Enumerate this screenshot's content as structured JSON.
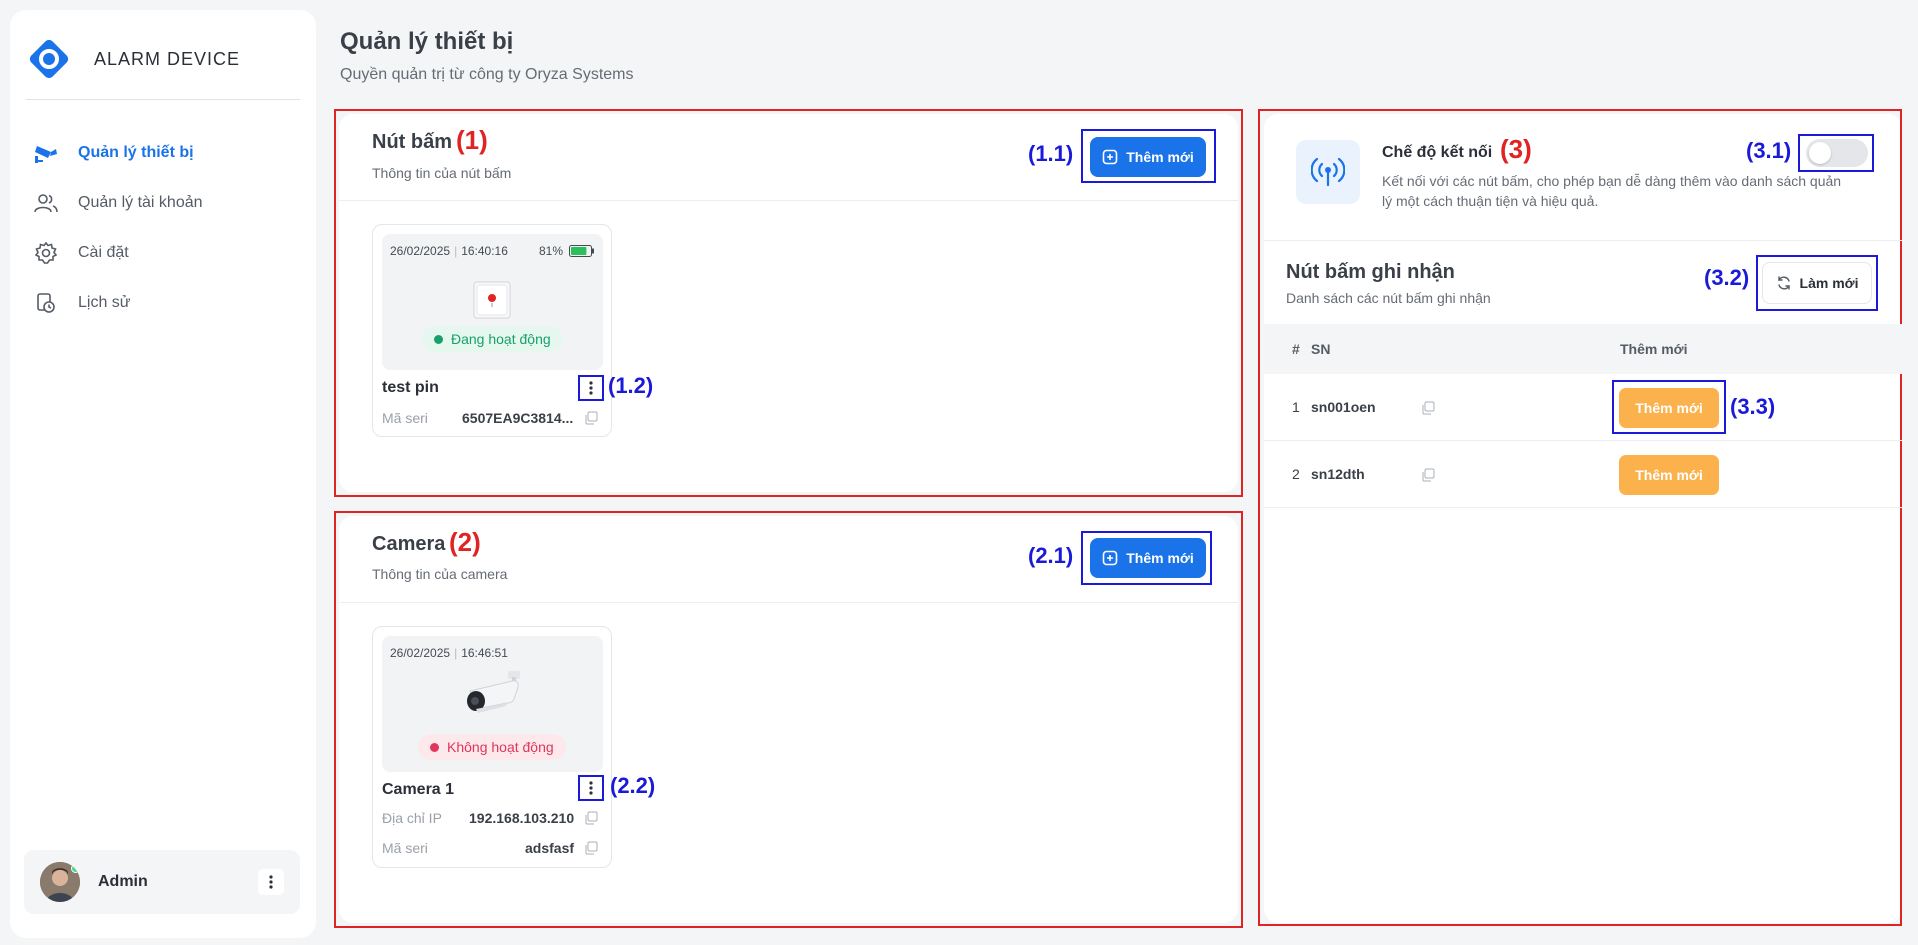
{
  "sidebar": {
    "brand_name": "ALARM DEVICE",
    "nav": [
      {
        "label": "Quản lý thiết bị"
      },
      {
        "label": "Quản lý tài khoản"
      },
      {
        "label": "Cài đặt"
      },
      {
        "label": "Lịch sử"
      }
    ],
    "user": {
      "name": "Admin"
    }
  },
  "header": {
    "title": "Quản lý thiết bị",
    "subtitle": "Quyền quản trị từ công ty Oryza Systems"
  },
  "buttons_section": {
    "title": "Nút bấm",
    "subtitle": "Thông tin của nút bấm",
    "add_label": "Thêm mới",
    "device": {
      "date": "26/02/2025",
      "time": "16:40:16",
      "battery": "81%",
      "battery_level": 0.81,
      "status": "Đang hoạt động",
      "name": "test pin",
      "serial_label": "Mã seri",
      "serial_value": "6507EA9C3814..."
    }
  },
  "camera_section": {
    "title": "Camera",
    "subtitle": "Thông tin của camera",
    "add_label": "Thêm mới",
    "device": {
      "date": "26/02/2025",
      "time": "16:46:51",
      "status": "Không hoạt động",
      "name": "Camera 1",
      "ip_label": "Địa chỉ IP",
      "ip_value": "192.168.103.210",
      "serial_label": "Mã seri",
      "serial_value": "adsfasf"
    }
  },
  "connection": {
    "title": "Chế độ kết nối",
    "description": "Kết nối với các nút bấm, cho phép bạn dễ dàng thêm vào danh sách quản lý một cách thuận tiện và hiệu quả.",
    "enabled": false
  },
  "recorded": {
    "title": "Nút bấm ghi nhận",
    "subtitle": "Danh sách các nút bấm ghi nhận",
    "refresh_label": "Làm mới",
    "columns": {
      "idx": "#",
      "sn": "SN",
      "action": "Thêm mới"
    },
    "rows": [
      {
        "idx": "1",
        "sn": "sn001oen",
        "action": "Thêm mới"
      },
      {
        "idx": "2",
        "sn": "sn12dth",
        "action": "Thêm mới"
      }
    ]
  },
  "annotations": {
    "a1": "(1)",
    "a11": "(1.1)",
    "a12": "(1.2)",
    "a2": "(2)",
    "a21": "(2.1)",
    "a22": "(2.2)",
    "a3": "(3)",
    "a31": "(3.1)",
    "a32": "(3.2)",
    "a33": "(3.3)"
  },
  "colors": {
    "primary": "#1a73e8",
    "annotation_red": "#e02424",
    "annotation_blue": "#1a1ad8",
    "orange": "#fbb24d",
    "active_green": "#17a06b",
    "inactive_red": "#e0365a"
  },
  "icons": {
    "brand": "alarm-logo-icon",
    "nav": [
      "camera-icon",
      "users-icon",
      "gear-icon",
      "history-icon"
    ],
    "connection": "wifi-signal-icon",
    "refresh": "refresh-icon",
    "copy": "copy-icon",
    "menu": "kebab-icon"
  }
}
